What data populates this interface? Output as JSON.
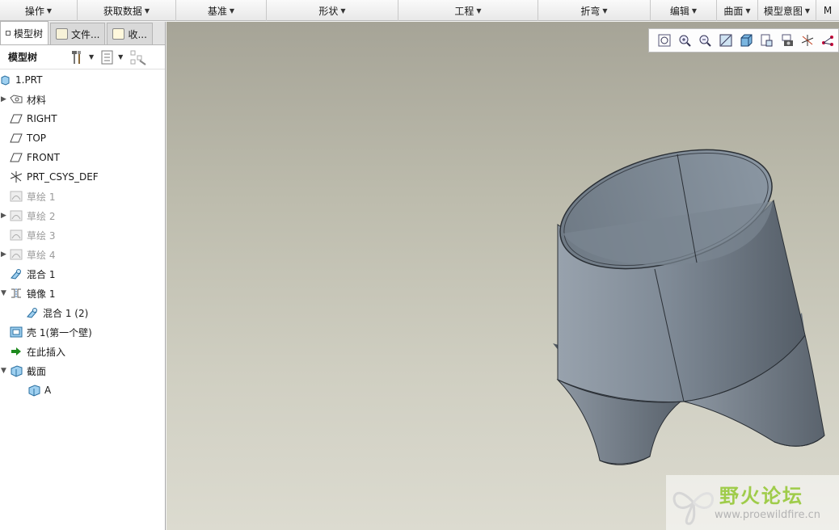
{
  "ribbon": {
    "groups": [
      {
        "label": "操作"
      },
      {
        "label": "获取数据"
      },
      {
        "label": "基准"
      },
      {
        "label": "形状"
      },
      {
        "label": "工程"
      },
      {
        "label": "折弯"
      },
      {
        "label": "编辑"
      },
      {
        "label": "曲面"
      },
      {
        "label": "模型意图"
      },
      {
        "label": "M"
      }
    ]
  },
  "panel": {
    "tabs": [
      {
        "label": "模型树"
      },
      {
        "label": "文件..."
      },
      {
        "label": "收..."
      }
    ],
    "title": "模型树"
  },
  "tree": [
    {
      "label": "1.PRT",
      "icon": "part-icon"
    },
    {
      "label": "材料",
      "icon": "material-icon",
      "expandable": true
    },
    {
      "label": "RIGHT",
      "icon": "datum-plane-icon"
    },
    {
      "label": "TOP",
      "icon": "datum-plane-icon"
    },
    {
      "label": "FRONT",
      "icon": "datum-plane-icon"
    },
    {
      "label": "PRT_CSYS_DEF",
      "icon": "coordinate-system-icon"
    },
    {
      "label": "草绘 1",
      "icon": "sketch-icon",
      "dim": true
    },
    {
      "label": "草绘 2",
      "icon": "sketch-icon",
      "dim": true,
      "expandable": true
    },
    {
      "label": "草绘 3",
      "icon": "sketch-icon",
      "dim": true
    },
    {
      "label": "草绘 4",
      "icon": "sketch-icon",
      "dim": true,
      "expandable": true
    },
    {
      "label": "混合 1",
      "icon": "blend-icon"
    },
    {
      "label": "镜像 1",
      "icon": "mirror-icon",
      "expanded": true
    },
    {
      "label": "混合 1 (2)",
      "icon": "blend-icon",
      "child": true
    },
    {
      "label": "壳 1(第一个壁)",
      "icon": "shell-icon"
    },
    {
      "label": "在此插入",
      "icon": "insert-here-icon"
    },
    {
      "label": "截面",
      "icon": "section-icon",
      "expanded": true
    },
    {
      "label": "A",
      "icon": "section-icon",
      "child": true
    }
  ],
  "watermark": {
    "title": "野火论坛",
    "url": "www.proewildfire.cn"
  },
  "colors": {
    "model_surface": "#7d8894",
    "model_dark": "#5a636d",
    "background_top": "#a6a497",
    "background_bottom": "#dcdbd0",
    "insert_arrow": "#1e8a1e"
  }
}
